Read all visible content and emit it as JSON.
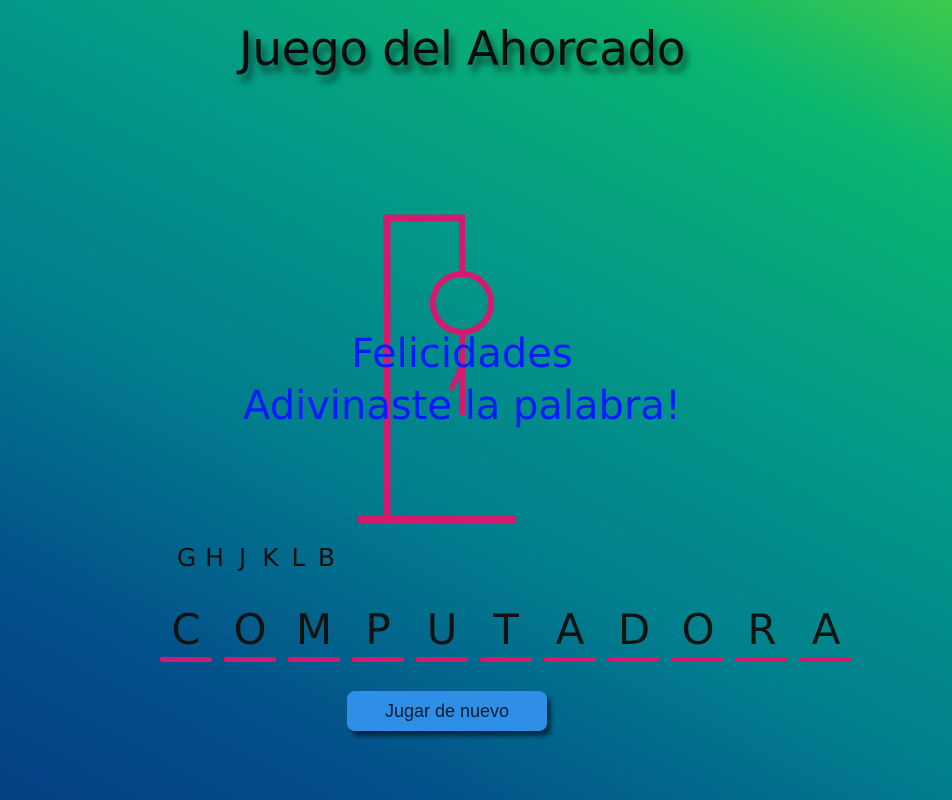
{
  "title": "Juego del Ahorcado",
  "message": {
    "line1": "Felicidades",
    "line2": "Adivinaste la palabra!"
  },
  "used_letters": [
    "G",
    "H",
    "J",
    "K",
    "L",
    "B"
  ],
  "word": [
    "C",
    "O",
    "M",
    "P",
    "U",
    "T",
    "A",
    "D",
    "O",
    "R",
    "A"
  ],
  "replay_button_label": "Jugar de nuevo",
  "colors": {
    "gallows": "#d6186e",
    "message": "#0a1aff",
    "button": "#2f8fe6"
  }
}
